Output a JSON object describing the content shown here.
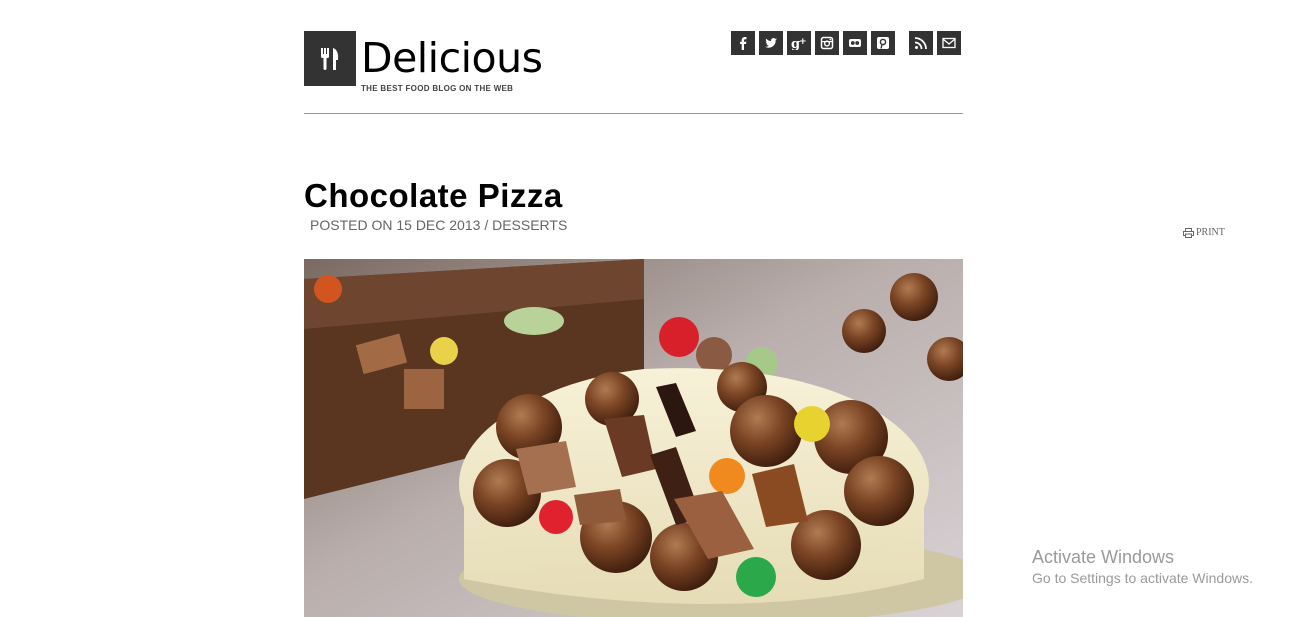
{
  "header": {
    "site_title": "Delicious",
    "tagline": "THE BEST FOOD BLOG ON THE WEB",
    "logo_icon": "fork-knife-icon"
  },
  "social": [
    {
      "name": "facebook-icon",
      "glyph": "f"
    },
    {
      "name": "twitter-icon",
      "glyph": "t"
    },
    {
      "name": "google-plus-icon",
      "glyph": "g+"
    },
    {
      "name": "instagram-icon",
      "glyph": "ig"
    },
    {
      "name": "flickr-icon",
      "glyph": "fl"
    },
    {
      "name": "pinterest-icon",
      "glyph": "p"
    },
    {
      "name": "rss-icon",
      "glyph": "rss"
    },
    {
      "name": "email-icon",
      "glyph": "mail"
    }
  ],
  "post": {
    "title": "Chocolate Pizza",
    "meta_prefix": "POSTED ON",
    "date": "15 DEC 2013",
    "separator": "/",
    "category": "DESSERTS",
    "print_label": "PRINT"
  },
  "watermark": {
    "title": "Activate Windows",
    "subtitle": "Go to Settings to activate Windows."
  },
  "colors": {
    "icon_bg": "#333333",
    "rule": "#9a9a9a",
    "meta_text": "#666666"
  }
}
